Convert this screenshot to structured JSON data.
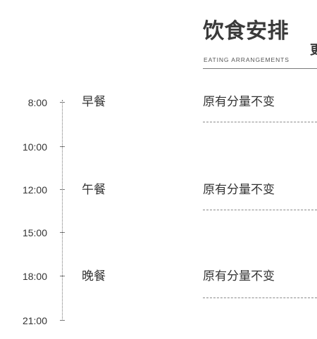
{
  "header": {
    "title": "饮食安排",
    "title_overflow": "更",
    "subtitle": "EATING ARRANGEMENTS"
  },
  "timeline": {
    "times": [
      "8:00",
      "10:00",
      "12:00",
      "15:00",
      "18:00",
      "21:00"
    ]
  },
  "meals": [
    {
      "name": "早餐",
      "content": "原有分量不变"
    },
    {
      "name": "午餐",
      "content": "原有分量不变"
    },
    {
      "name": "晚餐",
      "content": "原有分量不变"
    }
  ]
}
